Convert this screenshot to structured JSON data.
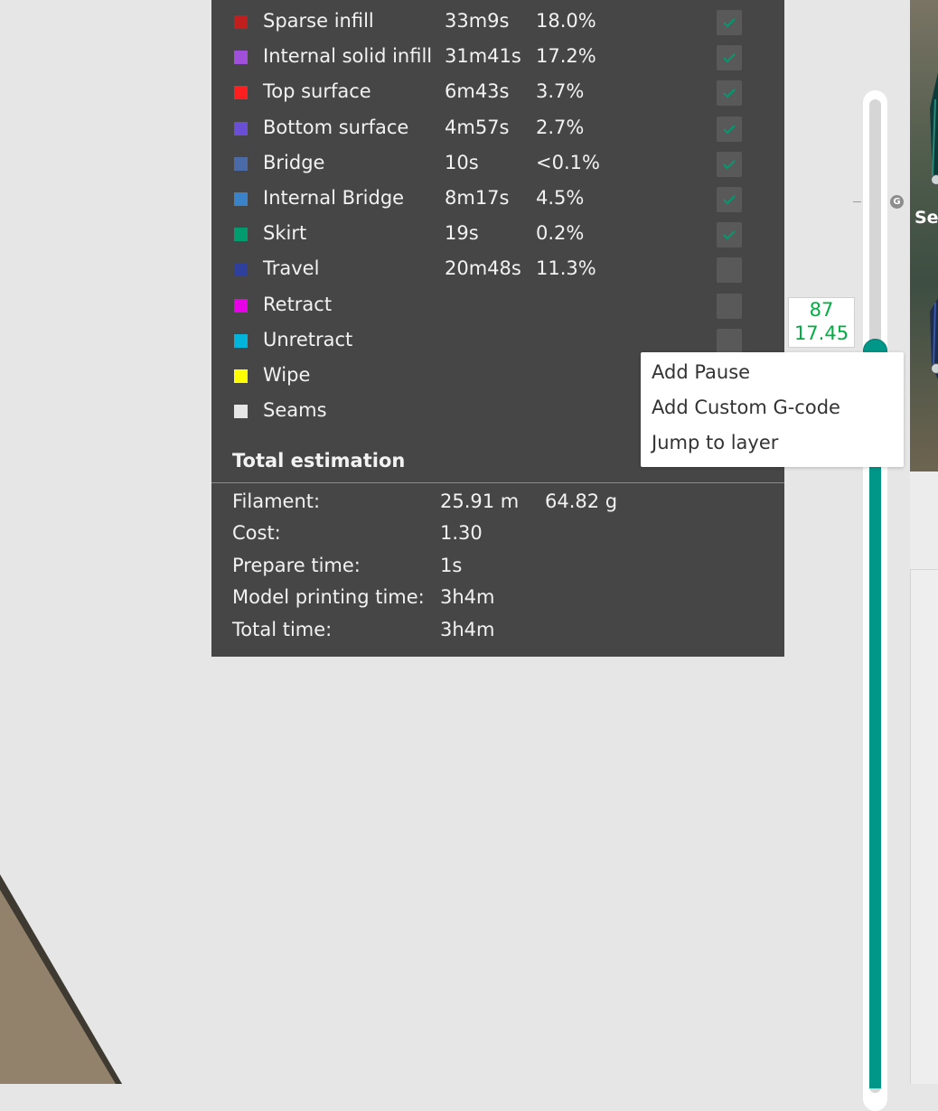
{
  "features": [
    {
      "name": "Sparse infill",
      "time": "33m9s",
      "percent": "18.0%",
      "color": "#c11e1e",
      "checked": true
    },
    {
      "name": "Internal solid infill",
      "time": "31m41s",
      "percent": "17.2%",
      "color": "#a04fdb",
      "checked": true
    },
    {
      "name": "Top surface",
      "time": "6m43s",
      "percent": "3.7%",
      "color": "#ff1f1f",
      "checked": true
    },
    {
      "name": "Bottom surface",
      "time": "4m57s",
      "percent": "2.7%",
      "color": "#6a4fd6",
      "checked": true
    },
    {
      "name": "Bridge",
      "time": "10s",
      "percent": "<0.1%",
      "color": "#4a6aa8",
      "checked": true
    },
    {
      "name": "Internal Bridge",
      "time": "8m17s",
      "percent": "4.5%",
      "color": "#3b83c9",
      "checked": true
    },
    {
      "name": "Skirt",
      "time": "19s",
      "percent": "0.2%",
      "color": "#009b6f",
      "checked": true
    },
    {
      "name": "Travel",
      "time": "20m48s",
      "percent": "11.3%",
      "color": "#2f3f9c",
      "checked": false
    },
    {
      "name": "Retract",
      "time": "",
      "percent": "",
      "color": "#e800e8",
      "checked": false
    },
    {
      "name": "Unretract",
      "time": "",
      "percent": "",
      "color": "#00b4dc",
      "checked": false
    },
    {
      "name": "Wipe",
      "time": "",
      "percent": "",
      "color": "#ffff00",
      "checked": false
    },
    {
      "name": "Seams",
      "time": "",
      "percent": "",
      "color": "#e6e6e6",
      "checked": null
    }
  ],
  "total": {
    "title": "Total estimation",
    "filament": {
      "label": "Filament:",
      "length": "25.91 m",
      "weight": "64.82 g"
    },
    "cost": {
      "label": "Cost:",
      "value": "1.30"
    },
    "prepare_time": {
      "label": "Prepare time:",
      "value": "1s"
    },
    "model_printing_time": {
      "label": "Model printing time:",
      "value": "3h4m"
    },
    "total_time": {
      "label": "Total time:",
      "value": "3h4m"
    }
  },
  "layer_slider": {
    "layer": "87",
    "height": "17.45",
    "accent_color": "#009688",
    "label_color": "#00ae42",
    "gcode_marker": "G"
  },
  "context_menu": {
    "items": [
      "Add Pause",
      "Add Custom G-code",
      "Jump to layer"
    ]
  },
  "side_panel": {
    "label": "Se"
  },
  "icons": {
    "checkbox": "check-icon",
    "gcode": "gcode-marker-icon"
  }
}
